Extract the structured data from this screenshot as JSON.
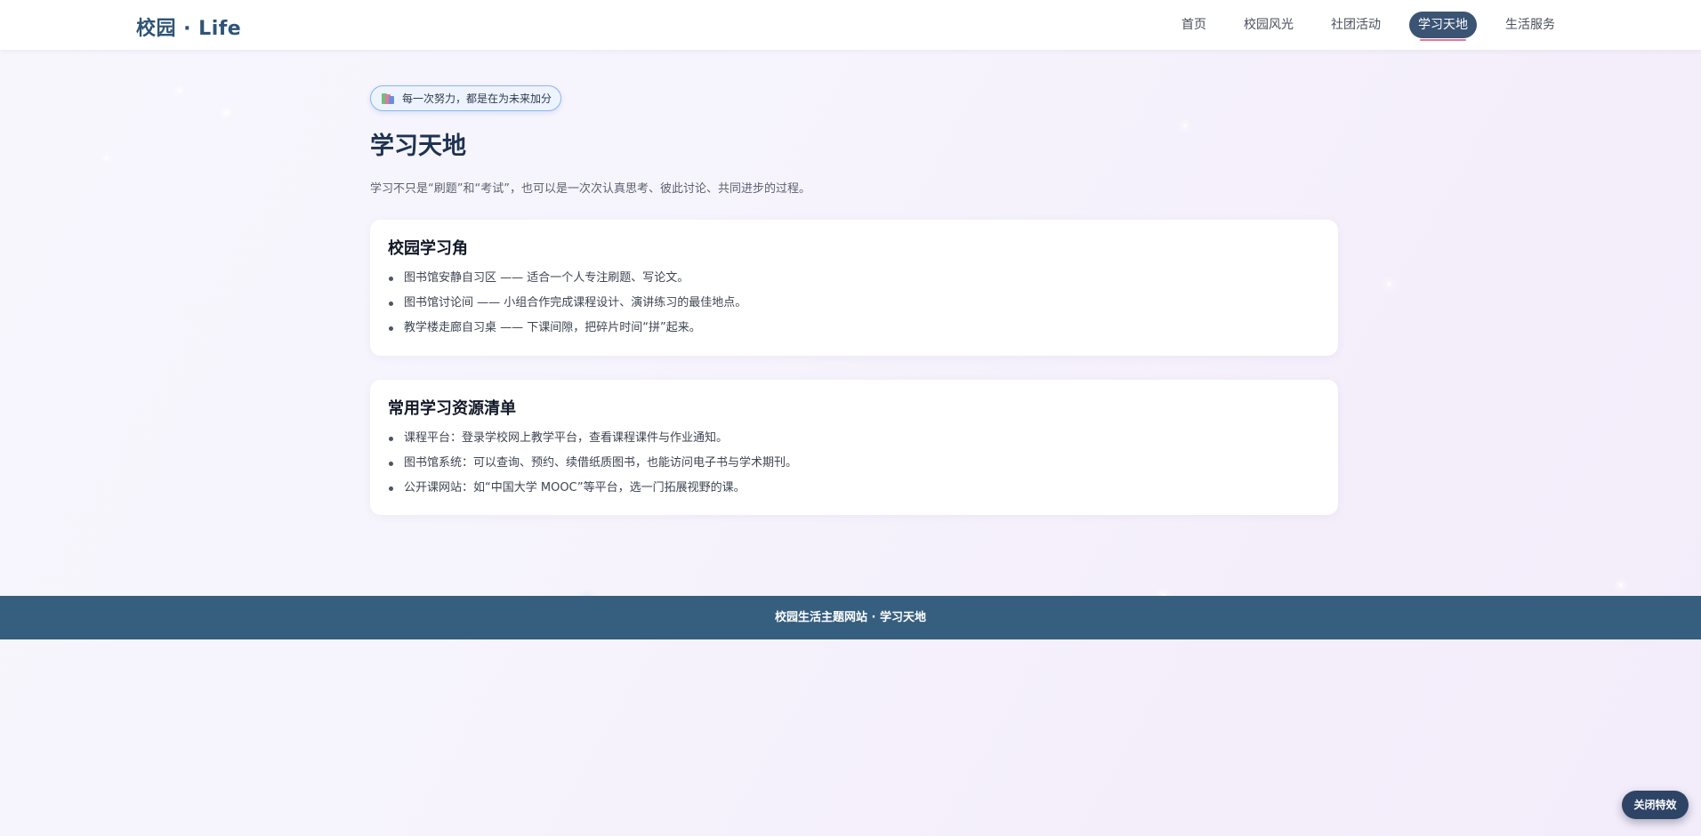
{
  "header": {
    "logo": "校园 · Life",
    "nav": [
      {
        "label": "首页",
        "active": false
      },
      {
        "label": "校园风光",
        "active": false
      },
      {
        "label": "社团活动",
        "active": false
      },
      {
        "label": "学习天地",
        "active": true
      },
      {
        "label": "生活服务",
        "active": false
      }
    ]
  },
  "hero": {
    "badge": "每一次努力，都是在为未来加分",
    "badge_icon": "books-icon",
    "title": "学习天地",
    "lead": "学习不只是“刷题”和“考试”，也可以是一次次认真思考、彼此讨论、共同进步的过程。"
  },
  "sections": [
    {
      "title": "校园学习角",
      "items": [
        "图书馆安静自习区 —— 适合一个人专注刷题、写论文。",
        "图书馆讨论间 —— 小组合作完成课程设计、演讲练习的最佳地点。",
        "教学楼走廊自习桌 —— 下课间隙，把碎片时间“拼”起来。"
      ]
    },
    {
      "title": "常用学习资源清单",
      "items": [
        "课程平台：登录学校网上教学平台，查看课程课件与作业通知。",
        "图书馆系统：可以查询、预约、续借纸质图书，也能访问电子书与学术期刊。",
        "公开课网站：如“中国大学 MOOC”等平台，选一门拓展视野的课。"
      ]
    }
  ],
  "footer": {
    "text": "校园生活主题网站 · 学习天地"
  },
  "fx_button": {
    "label": "关闭特效"
  },
  "colors": {
    "brand": "#2f5476",
    "nav_active_bg": "#3b5474",
    "nav_active_underline": "#e57396",
    "footer_bg": "#365e7f",
    "fx_button_bg": "#2e4466"
  }
}
